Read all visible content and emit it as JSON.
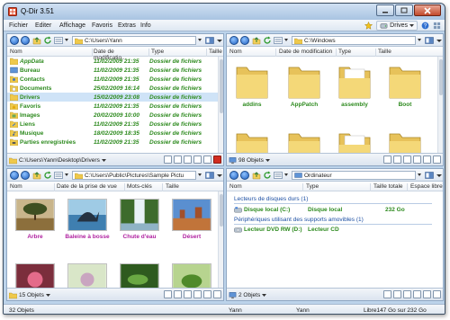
{
  "window": {
    "title": "Q-Dir 3.51"
  },
  "menu": {
    "items": [
      "Fichier",
      "Editer",
      "Affichage",
      "Favoris",
      "Extras",
      "Info"
    ],
    "drives_label": "Drives"
  },
  "pane_tl": {
    "path": "C:\\Users\\Yann",
    "columns": [
      "Nom",
      "Date de modificatio...",
      "Type",
      "Taille"
    ],
    "rows": [
      {
        "name": "AppData",
        "date": "11/02/2009 21:35",
        "type": "Dossier de fichiers"
      },
      {
        "name": "Bureau",
        "date": "11/02/2009 21:35",
        "type": "Dossier de fichiers"
      },
      {
        "name": "Contacts",
        "date": "11/02/2009 21:35",
        "type": "Dossier de fichiers"
      },
      {
        "name": "Documents",
        "date": "25/02/2009 16:14",
        "type": "Dossier de fichiers"
      },
      {
        "name": "Drivers",
        "date": "15/02/2009 23:08",
        "type": "Dossier de fichiers"
      },
      {
        "name": "Favoris",
        "date": "11/02/2009 21:35",
        "type": "Dossier de fichiers"
      },
      {
        "name": "Images",
        "date": "20/02/2009 10:00",
        "type": "Dossier de fichiers"
      },
      {
        "name": "Liens",
        "date": "11/02/2009 21:35",
        "type": "Dossier de fichiers"
      },
      {
        "name": "Musique",
        "date": "18/02/2009 18:35",
        "type": "Dossier de fichiers"
      },
      {
        "name": "Parties enregistrées",
        "date": "11/02/2009 21:35",
        "type": "Dossier de fichiers"
      }
    ],
    "status_path": "C:\\Users\\Yann\\Desktop\\Drivers"
  },
  "pane_tr": {
    "path": "C:\\Windows",
    "columns": [
      "Nom",
      "Date de modification",
      "Type",
      "Taille"
    ],
    "folders": [
      "addins",
      "AppPatch",
      "assembly",
      "Boot"
    ],
    "status_count": "98 Objets"
  },
  "pane_bl": {
    "path": "C:\\Users\\Public\\Pictures\\Sample Pictu",
    "columns": [
      "Nom",
      "Date de la prise de vue",
      "Mots-clés",
      "Taille"
    ],
    "thumbnails": [
      "Arbre",
      "Baleine à bosse",
      "Chute d'eau",
      "Désert"
    ],
    "status_count": "15 Objets"
  },
  "pane_br": {
    "path": "Ordinateur",
    "columns": [
      "Nom",
      "Type",
      "Taille totale",
      "Espace libre"
    ],
    "section_hdd": "Lecteurs de disques durs (1)",
    "hdd": {
      "name": "Disque local (C:)",
      "type": "Disque local",
      "size": "232 Go"
    },
    "section_removable": "Périphériques utilisant des supports amovibles (1)",
    "dvd": {
      "name": "Lecteur DVD RW (D:)",
      "type": "Lecteur CD"
    },
    "status_count": "2 Objets"
  },
  "footer": {
    "objects": "32 Objets",
    "user1": "Yann",
    "user2": "Yann",
    "free": "Libre147 Go sur 232 Go"
  }
}
